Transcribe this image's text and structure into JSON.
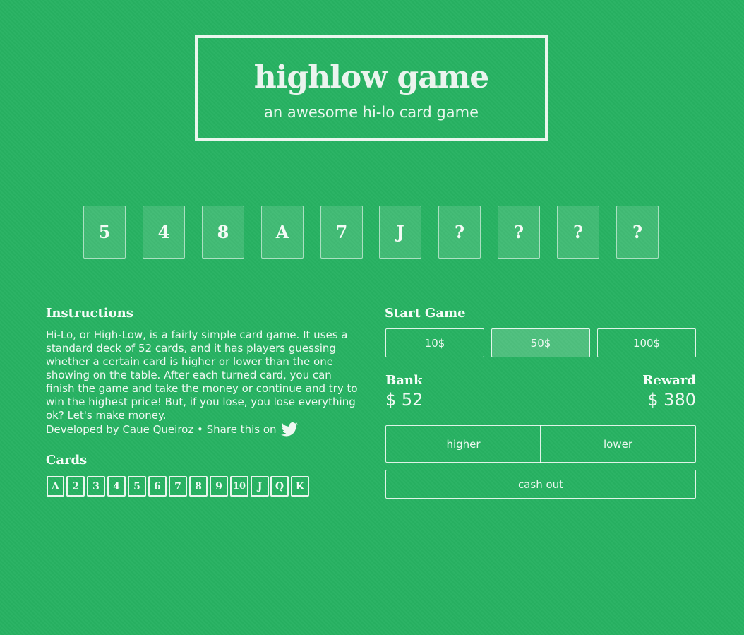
{
  "header": {
    "title": "highlow game",
    "subtitle": "an awesome hi-lo card game"
  },
  "table_cards": [
    "5",
    "4",
    "8",
    "A",
    "7",
    "J",
    "?",
    "?",
    "?",
    "?"
  ],
  "instructions": {
    "heading": "Instructions",
    "text": "Hi-Lo, or High-Low, is a fairly simple card game. It uses a standard deck of 52 cards, and it has players guessing whether a certain card is higher or lower than the one showing on the table. After each turned card, you can finish the game and take the money or continue and try to win the highest price! But, if you lose, you lose everything ok? Let's make money."
  },
  "credits": {
    "developed_by": "Developed by",
    "author": "Caue Queiroz",
    "share": "• Share this on",
    "share_icon": "twitter-icon"
  },
  "cards_legend": {
    "heading": "Cards",
    "values": [
      "A",
      "2",
      "3",
      "4",
      "5",
      "6",
      "7",
      "8",
      "9",
      "10",
      "J",
      "Q",
      "K"
    ]
  },
  "start_game": {
    "heading": "Start Game",
    "bets": [
      "10$",
      "50$",
      "100$"
    ],
    "selected_bet": "50$"
  },
  "bank": {
    "label": "Bank",
    "value": "$ 52"
  },
  "reward": {
    "label": "Reward",
    "value": "$ 380"
  },
  "actions": {
    "higher": "higher",
    "lower": "lower",
    "cash_out": "cash out"
  },
  "colors": {
    "background": "#27b262",
    "foreground": "#eaf6ee"
  }
}
